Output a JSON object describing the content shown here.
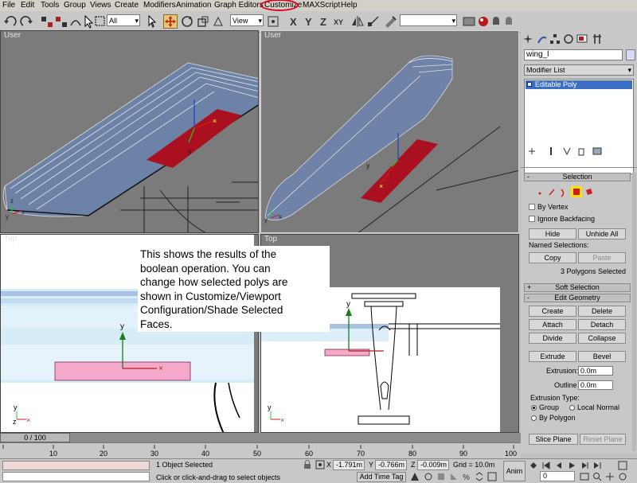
{
  "menu": [
    "File",
    "Edit",
    "Tools",
    "Group",
    "Views",
    "Create",
    "Modifiers",
    "Animation",
    "Graph Editors",
    "Customize",
    "MAXScript",
    "Help"
  ],
  "toolbar": {
    "selection_filter": "All",
    "ref_coord": "View"
  },
  "viewports": {
    "top_left": "User",
    "top_right": "User",
    "bottom_left": "Top",
    "bottom_right": "Top"
  },
  "annotation": "This shows the results of the\nboolean operation.  You can\nchange how selected polys are\nshown in Customize/Viewport\nConfiguration/Shade Selected\nFaces.",
  "panel": {
    "object_name": "wing_l",
    "modifier_list": "Modifier List",
    "stack_item": "Editable Poly",
    "selection": {
      "title": "Selection",
      "by_vertex": "By Vertex",
      "ignore_backfacing": "Ignore Backfacing",
      "hide": "Hide",
      "unhide_all": "Unhide All",
      "named_selections": "Named Selections:",
      "copy": "Copy",
      "paste": "Paste",
      "status": "3 Polygons Selected"
    },
    "soft_selection": "Soft Selection",
    "edit_geometry": {
      "title": "Edit Geometry",
      "create": "Create",
      "delete": "Delete",
      "attach": "Attach",
      "detach": "Detach",
      "divide": "Divide",
      "collapse": "Collapse",
      "extrude": "Extrude",
      "bevel": "Bevel",
      "extrusion_label": "Extrusion:",
      "extrusion_value": "0.0m",
      "outline_label": "Outline",
      "outline_value": "0.0m",
      "extrusion_type": "Extrusion Type:",
      "group": "Group",
      "local_normal": "Local Normal",
      "by_polygon": "By Polygon",
      "slice_plane": "Slice Plane",
      "reset_plane": "Reset Plane"
    }
  },
  "timeline": {
    "frame_slider": "0 / 100",
    "ticks": [
      "10",
      "20",
      "30",
      "40",
      "50",
      "60",
      "70",
      "80",
      "90",
      "100"
    ]
  },
  "status": {
    "selected": "1 Object Selected",
    "prompt": "Click or click-and-drag to select objects",
    "x_label": "X",
    "x_value": "-1.791m",
    "y_label": "Y",
    "y_value": "-0.766m",
    "z_label": "Z",
    "z_value": "-0.009m",
    "grid": "Grid = 10.0m",
    "add_time_tag": "Add Time Tag",
    "anim": "Anim",
    "frame": "0"
  },
  "colors": {
    "highlight_red": "#e0001e",
    "selected_face": "#aa1020",
    "wing_blue": "#6f83a8",
    "panel_gray": "#c8c8c8",
    "viewport_gray": "#7b7b7b"
  }
}
